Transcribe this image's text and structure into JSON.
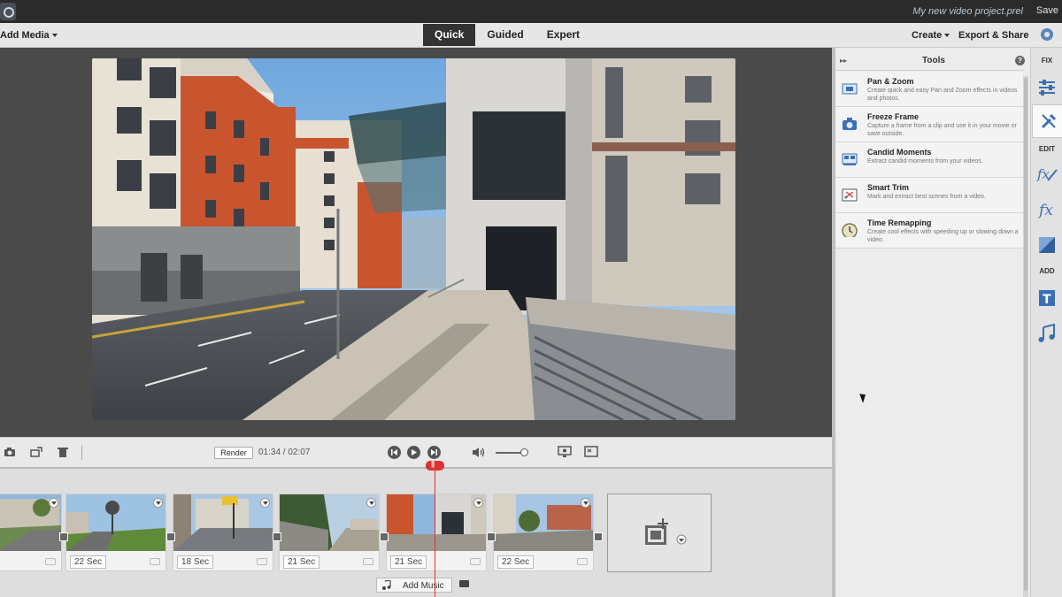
{
  "titlebar": {
    "project_name": "My new video project.prel",
    "save_label": "Save"
  },
  "menubar": {
    "add_media_label": "Add Media",
    "modes": [
      {
        "label": "Quick",
        "active": true
      },
      {
        "label": "Guided",
        "active": false
      },
      {
        "label": "Expert",
        "active": false
      }
    ],
    "create_label": "Create",
    "export_label": "Export & Share"
  },
  "controls": {
    "render_label": "Render",
    "timecode": "01:34 / 02:07",
    "volume_level": 0.9
  },
  "timeline": {
    "clips": [
      {
        "duration": ""
      },
      {
        "duration": "22 Sec"
      },
      {
        "duration": "18 Sec"
      },
      {
        "duration": "21 Sec"
      },
      {
        "duration": "21 Sec"
      },
      {
        "duration": "22 Sec"
      }
    ],
    "add_music_label": "Add Music"
  },
  "tools": {
    "title": "Tools",
    "items": [
      {
        "name": "Pan & Zoom",
        "desc": "Create quick and easy Pan and Zoom effects in videos and photos."
      },
      {
        "name": "Freeze Frame",
        "desc": "Capture a frame from a clip and use it in your movie or save outside."
      },
      {
        "name": "Candid Moments",
        "desc": "Extract candid moments from your videos."
      },
      {
        "name": "Smart Trim",
        "desc": "Mark and extract best scenes from a video."
      },
      {
        "name": "Time Remapping",
        "desc": "Create cool effects with speeding up or slowing down a video."
      }
    ]
  },
  "rail": {
    "fix_label": "FIX",
    "edit_label": "EDIT",
    "add_label": "ADD"
  },
  "colors": {
    "accent_blue": "#3a6fb5",
    "playhead_red": "#d33333",
    "dark_chrome": "#2b2b2b"
  }
}
